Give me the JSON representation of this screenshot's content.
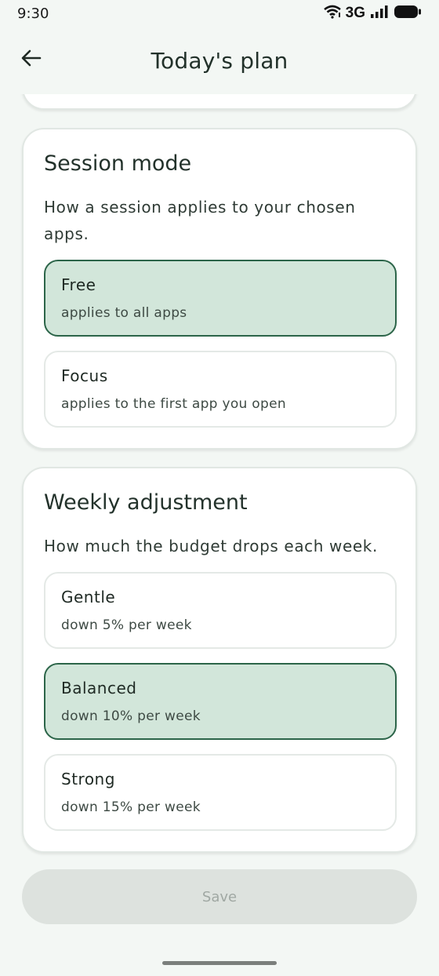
{
  "status_bar": {
    "time": "9:30",
    "network": "3G"
  },
  "header": {
    "title": "Today's plan"
  },
  "session_mode": {
    "title": "Session mode",
    "description": "How a session applies to your chosen apps.",
    "options": [
      {
        "title": "Free",
        "subtitle": "applies to all apps",
        "selected": true
      },
      {
        "title": "Focus",
        "subtitle": "applies to the first app you open",
        "selected": false
      }
    ]
  },
  "weekly_adjustment": {
    "title": "Weekly adjustment",
    "description": "How much the budget drops each week.",
    "options": [
      {
        "title": "Gentle",
        "subtitle": "down 5% per week",
        "selected": false
      },
      {
        "title": "Balanced",
        "subtitle": "down 10% per week",
        "selected": true
      },
      {
        "title": "Strong",
        "subtitle": "down 15% per week",
        "selected": false
      }
    ]
  },
  "footer": {
    "save_label": "Save",
    "save_enabled": false
  },
  "colors": {
    "selected_bg": "#d2e6da",
    "selected_border": "#2c6549",
    "background": "#f3f7f4"
  }
}
